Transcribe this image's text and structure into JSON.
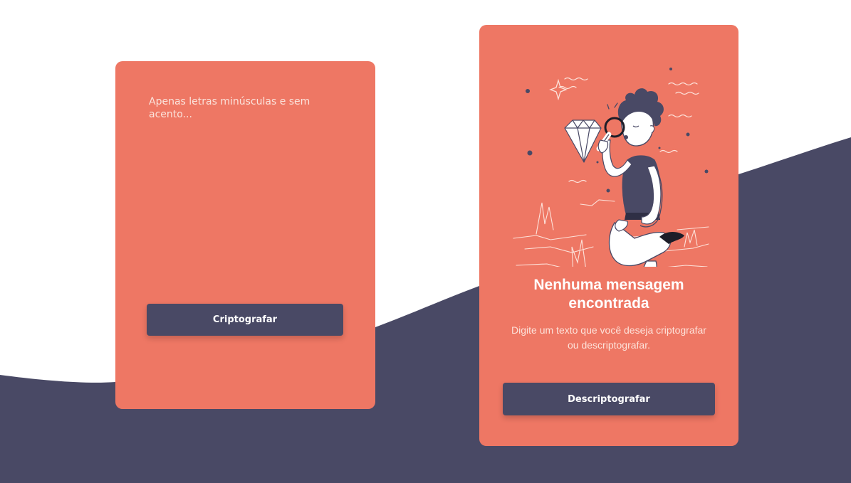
{
  "colors": {
    "background": "#ffffff",
    "wave": "#494965",
    "card": "#ee7764",
    "button": "#494965",
    "button_text": "#ffffff"
  },
  "encrypt_card": {
    "input_placeholder": "Apenas letras minúsculas e sem acento...",
    "input_value": "",
    "encrypt_button_label": "Criptografar"
  },
  "result_card": {
    "illustration_icon": "person-with-magnifying-glass-and-diamond",
    "empty_title": "Nenhuma mensagem encontrada",
    "empty_text": "Digite um texto que você deseja criptografar ou descriptografar.",
    "decrypt_button_label": "Descriptografar"
  }
}
